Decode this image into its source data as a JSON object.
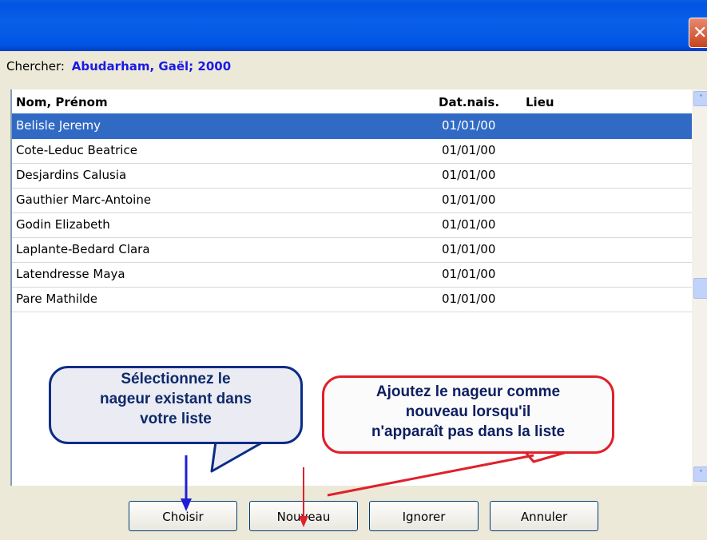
{
  "window": {
    "title": "",
    "close_icon": "close-icon",
    "close_glyph": "✕"
  },
  "search": {
    "label": "Chercher:",
    "value": "Abudarham, Gaël; 2000"
  },
  "list": {
    "columns": [
      "Nom, Prénom",
      "Dat.nais.",
      "Lieu"
    ],
    "rows": [
      {
        "name": "Belisle Jeremy",
        "date": "01/01/00",
        "selected": true
      },
      {
        "name": "Cote-Leduc Beatrice",
        "date": "01/01/00"
      },
      {
        "name": "Desjardins Calusia",
        "date": "01/01/00"
      },
      {
        "name": "Gauthier Marc-Antoine",
        "date": "01/01/00"
      },
      {
        "name": "Godin Elizabeth",
        "date": "01/01/00"
      },
      {
        "name": "Laplante-Bedard Clara",
        "date": "01/01/00"
      },
      {
        "name": "Latendresse Maya",
        "date": "01/01/00"
      },
      {
        "name": "Pare Mathilde",
        "date": "01/01/00"
      }
    ]
  },
  "scrollbar": {
    "up_glyph": "˄",
    "down_glyph": "˅"
  },
  "buttons": {
    "choisir": "Choisir",
    "nouveau": "Nouveau",
    "ignorer": "Ignorer",
    "annuler": "Annuler"
  },
  "callouts": {
    "blue": [
      "Sélectionnez le",
      "nageur existant dans",
      "votre liste"
    ],
    "red": [
      "Ajoutez le nageur comme",
      "nouveau lorsqu'il",
      "n'apparaît pas dans la liste"
    ]
  },
  "colors": {
    "titlebar": "#0054e3",
    "selection": "#316ac5",
    "search_value": "#1a1ae6",
    "blue_arrow": "#1f1fd8",
    "red_arrow": "#e0202a"
  }
}
